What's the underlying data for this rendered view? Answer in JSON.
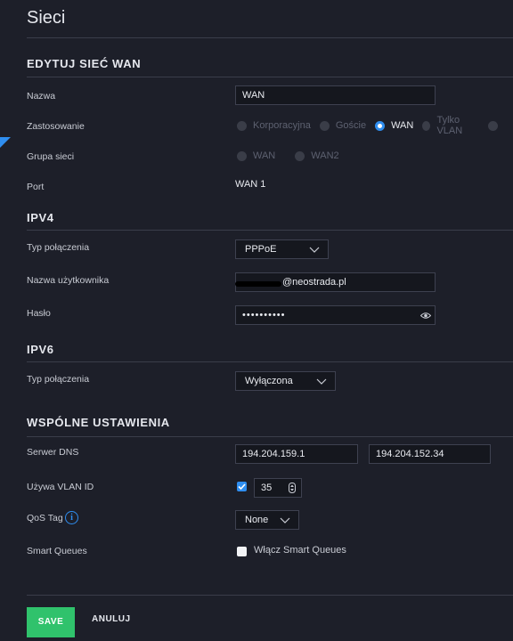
{
  "page_title": "Sieci",
  "sections": {
    "wan": "EDYTUJ SIEĆ WAN",
    "ipv4": "IPV4",
    "ipv6": "IPV6",
    "common": "WSPÓLNE USTAWIENIA"
  },
  "wan": {
    "name_label": "Nazwa",
    "name_value": "WAN",
    "usage_label": "Zastosowanie",
    "usage_options": [
      "Korporacyjna",
      "Goście",
      "WAN",
      "Tylko VLAN"
    ],
    "usage_selected": "WAN",
    "group_label": "Grupa sieci",
    "group_options": [
      "WAN",
      "WAN2"
    ],
    "port_label": "Port",
    "port_value": "WAN 1"
  },
  "ipv4": {
    "conn_type_label": "Typ połączenia",
    "conn_type_value": "PPPoE",
    "username_label": "Nazwa użytkownika",
    "username_value": "@neostrada.pl",
    "password_label": "Hasło",
    "password_value": "••••••••••"
  },
  "ipv6": {
    "conn_type_label": "Typ połączenia",
    "conn_type_value": "Wyłączona"
  },
  "common": {
    "dns_label": "Serwer DNS",
    "dns1": "194.204.159.1",
    "dns2": "194.204.152.34",
    "vlan_label": "Używa VLAN ID",
    "vlan_checked": true,
    "vlan_value": "35",
    "qos_label": "QoS Tag",
    "qos_value": "None",
    "smart_label": "Smart Queues",
    "smart_checkbox_label": "Włącz Smart Queues",
    "smart_checked": false
  },
  "actions": {
    "save": "SAVE",
    "cancel": "ANULUJ"
  },
  "colors": {
    "background": "#1d1f29",
    "accent": "#2f8ef0",
    "save": "#30c26c"
  },
  "icons": [
    "chevron-down-icon",
    "eye-icon",
    "info-icon",
    "stepper-icon"
  ]
}
